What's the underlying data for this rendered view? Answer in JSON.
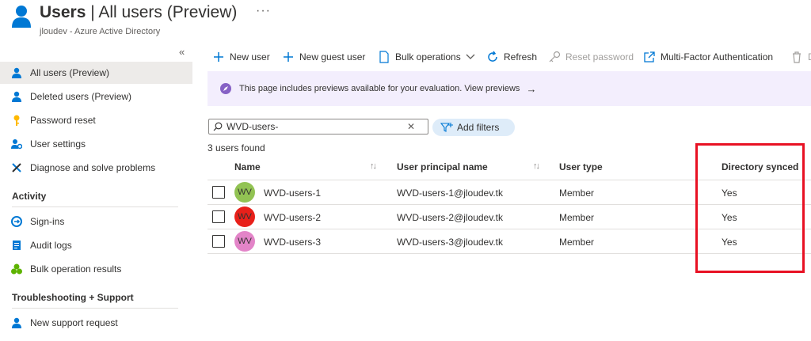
{
  "header": {
    "title_bold": "Users",
    "title_rest": " | All users (Preview)",
    "more": "···",
    "subtitle": "jloudev - Azure Active Directory"
  },
  "sidebar": {
    "collapse": "«",
    "items": [
      {
        "label": "All users (Preview)",
        "icon": "user-icon"
      },
      {
        "label": "Deleted users (Preview)",
        "icon": "user-icon"
      },
      {
        "label": "Password reset",
        "icon": "key-icon"
      },
      {
        "label": "User settings",
        "icon": "user-settings-icon"
      },
      {
        "label": "Diagnose and solve problems",
        "icon": "wrench-icon"
      }
    ],
    "sections": [
      {
        "title": "Activity",
        "items": [
          {
            "label": "Sign-ins",
            "icon": "sign-in-icon"
          },
          {
            "label": "Audit logs",
            "icon": "audit-log-icon"
          },
          {
            "label": "Bulk operation results",
            "icon": "bulk-results-icon"
          }
        ]
      },
      {
        "title": "Troubleshooting + Support",
        "items": [
          {
            "label": "New support request",
            "icon": "support-icon"
          }
        ]
      }
    ]
  },
  "toolbar": {
    "new_user": "New user",
    "new_guest_user": "New guest user",
    "bulk_operations": "Bulk operations",
    "refresh": "Refresh",
    "reset_password": "Reset password",
    "mfa": "Multi-Factor Authentication",
    "delete": "D"
  },
  "banner": {
    "text": "This page includes previews available for your evaluation. View previews",
    "arrow": "→"
  },
  "search": {
    "value": "WVD-users-",
    "clear": "✕"
  },
  "filters": {
    "add_filters": "Add filters"
  },
  "results": {
    "count_text": "3 users found"
  },
  "table": {
    "columns": {
      "name": "Name",
      "upn": "User principal name",
      "user_type": "User type",
      "directory_synced": "Directory synced"
    },
    "rows": [
      {
        "initials": "WV",
        "avatar_color": "#92c353",
        "name": "WVD-users-1",
        "upn": "WVD-users-1@jloudev.tk",
        "user_type": "Member",
        "directory_synced": "Yes"
      },
      {
        "initials": "WV",
        "avatar_color": "#e8201a",
        "name": "WVD-users-2",
        "upn": "WVD-users-2@jloudev.tk",
        "user_type": "Member",
        "directory_synced": "Yes"
      },
      {
        "initials": "WV",
        "avatar_color": "#e384c8",
        "name": "WVD-users-3",
        "upn": "WVD-users-3@jloudev.tk",
        "user_type": "Member",
        "directory_synced": "Yes"
      }
    ]
  },
  "colors": {
    "accent": "#0078d4",
    "highlight": "#e81123",
    "banner_bg": "#f3eefd",
    "active_nav": "#edebe9"
  }
}
